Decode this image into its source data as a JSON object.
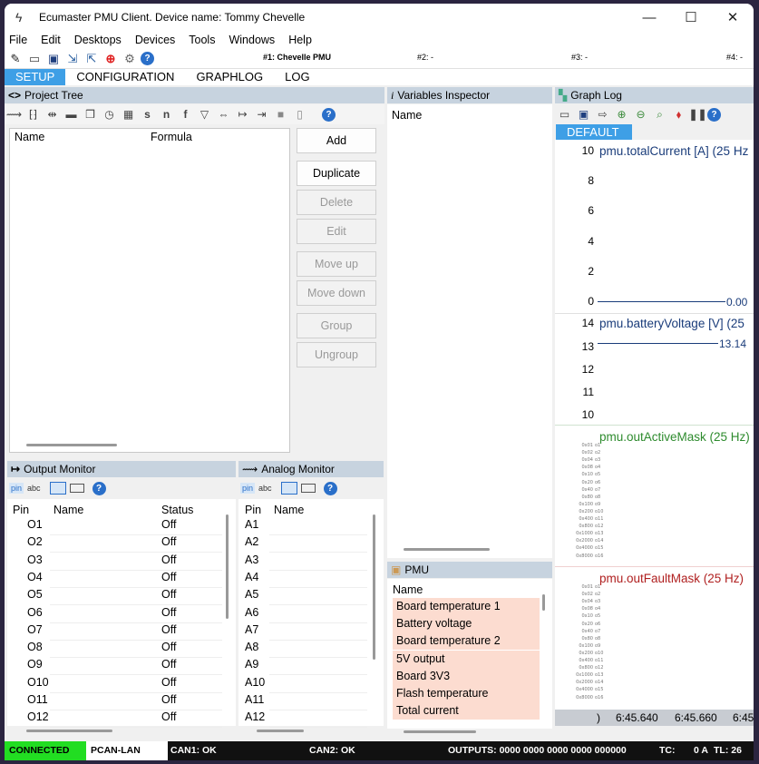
{
  "window": {
    "title": "Ecumaster PMU Client. Device name: Tommy Chevelle",
    "minimize_icon": "minimize-icon",
    "maximize_icon": "maximize-icon",
    "close_icon": "close-icon"
  },
  "menu": [
    "File",
    "Edit",
    "Desktops",
    "Devices",
    "Tools",
    "Windows",
    "Help"
  ],
  "device_tabs": [
    "#1: Chevelle PMU",
    "#2: -",
    "#3: -",
    "#4: -"
  ],
  "main_tabs": [
    "SETUP",
    "CONFIGURATION",
    "GRAPHLOG",
    "LOG"
  ],
  "project_tree": {
    "title": "Project Tree",
    "toolbar_letters": [
      "s",
      "n",
      "f"
    ],
    "columns": [
      "Name",
      "Formula"
    ],
    "buttons": [
      {
        "label": "Add",
        "enabled": true
      },
      {
        "label": "Duplicate",
        "enabled": true
      },
      {
        "label": "Delete",
        "enabled": false
      },
      {
        "label": "Edit",
        "enabled": false
      },
      {
        "label": "Move up",
        "enabled": false
      },
      {
        "label": "Move down",
        "enabled": false
      },
      {
        "label": "Group",
        "enabled": false
      },
      {
        "label": "Ungroup",
        "enabled": false
      }
    ]
  },
  "output_monitor": {
    "title": "Output Monitor",
    "view_labels": [
      "pin",
      "abc"
    ],
    "columns": [
      "Pin",
      "Name",
      "Status"
    ],
    "rows": [
      {
        "pin": "O1",
        "status": "Off"
      },
      {
        "pin": "O2",
        "status": "Off"
      },
      {
        "pin": "O3",
        "status": "Off"
      },
      {
        "pin": "O4",
        "status": "Off"
      },
      {
        "pin": "O5",
        "status": "Off"
      },
      {
        "pin": "O6",
        "status": "Off"
      },
      {
        "pin": "O7",
        "status": "Off"
      },
      {
        "pin": "O8",
        "status": "Off"
      },
      {
        "pin": "O9",
        "status": "Off"
      },
      {
        "pin": "O10",
        "status": "Off"
      },
      {
        "pin": "O11",
        "status": "Off"
      },
      {
        "pin": "O12",
        "status": "Off"
      }
    ]
  },
  "analog_monitor": {
    "title": "Analog Monitor",
    "view_labels": [
      "pin",
      "abc"
    ],
    "columns": [
      "Pin",
      "Name"
    ],
    "rows": [
      "A1",
      "A2",
      "A3",
      "A4",
      "A5",
      "A6",
      "A7",
      "A8",
      "A9",
      "A10",
      "A11",
      "A12"
    ]
  },
  "variables_inspector": {
    "title": "Variables Inspector",
    "column": "Name"
  },
  "pmu_panel": {
    "title": "PMU",
    "column": "Name",
    "rows": [
      "Board temperature 1",
      "Battery voltage",
      "Board temperature 2",
      "5V output",
      "Board 3V3",
      "Flash temperature",
      "Total current"
    ]
  },
  "graph_log": {
    "title": "Graph Log",
    "preset": "DEFAULT",
    "graphs": [
      {
        "title": "pmu.totalCurrent [A] (25 Hz",
        "color": "#1a3c7a",
        "yticks": [
          "10",
          "8",
          "6",
          "4",
          "2",
          "0"
        ],
        "value_label": "0.00"
      },
      {
        "title": "pmu.batteryVoltage [V] (25",
        "color": "#1a3c7a",
        "yticks": [
          "14",
          "13",
          "12",
          "11",
          "10"
        ],
        "value_label": "13.14"
      },
      {
        "title": "pmu.outActiveMask (25 Hz)",
        "color": "#2e8b2e"
      },
      {
        "title": "pmu.outFaultMask (25 Hz)",
        "color": "#b02020"
      }
    ],
    "mask_hex": [
      "0x01",
      "0x02",
      "0x04",
      "0x08",
      "0x10",
      "0x20",
      "0x40",
      "0x80",
      "0x100",
      "0x200",
      "0x400",
      "0x800",
      "0x1000",
      "0x2000",
      "0x4000",
      "0x8000"
    ],
    "mask_outputs": [
      "o1",
      "o2",
      "o3",
      "o4",
      "o5",
      "o6",
      "o7",
      "o8",
      "o9",
      "o10",
      "o11",
      "o12",
      "o13",
      "o14",
      "o15",
      "o16"
    ],
    "time_labels": [
      ")",
      "6:45.640",
      "6:45.660",
      "6:45"
    ]
  },
  "status_bar": {
    "connection": "CONNECTED",
    "interface": "PCAN-LAN",
    "can1": "CAN1: OK",
    "can2": "CAN2: OK",
    "outputs": "OUTPUTS: 0000 0000 0000 0000  000000",
    "tc_label": "TC:",
    "tc_value": "0 A",
    "tl": "TL:   26",
    "colors": {
      "connected_bg": "#22dd22",
      "interface_bg": "#ffffff"
    }
  }
}
